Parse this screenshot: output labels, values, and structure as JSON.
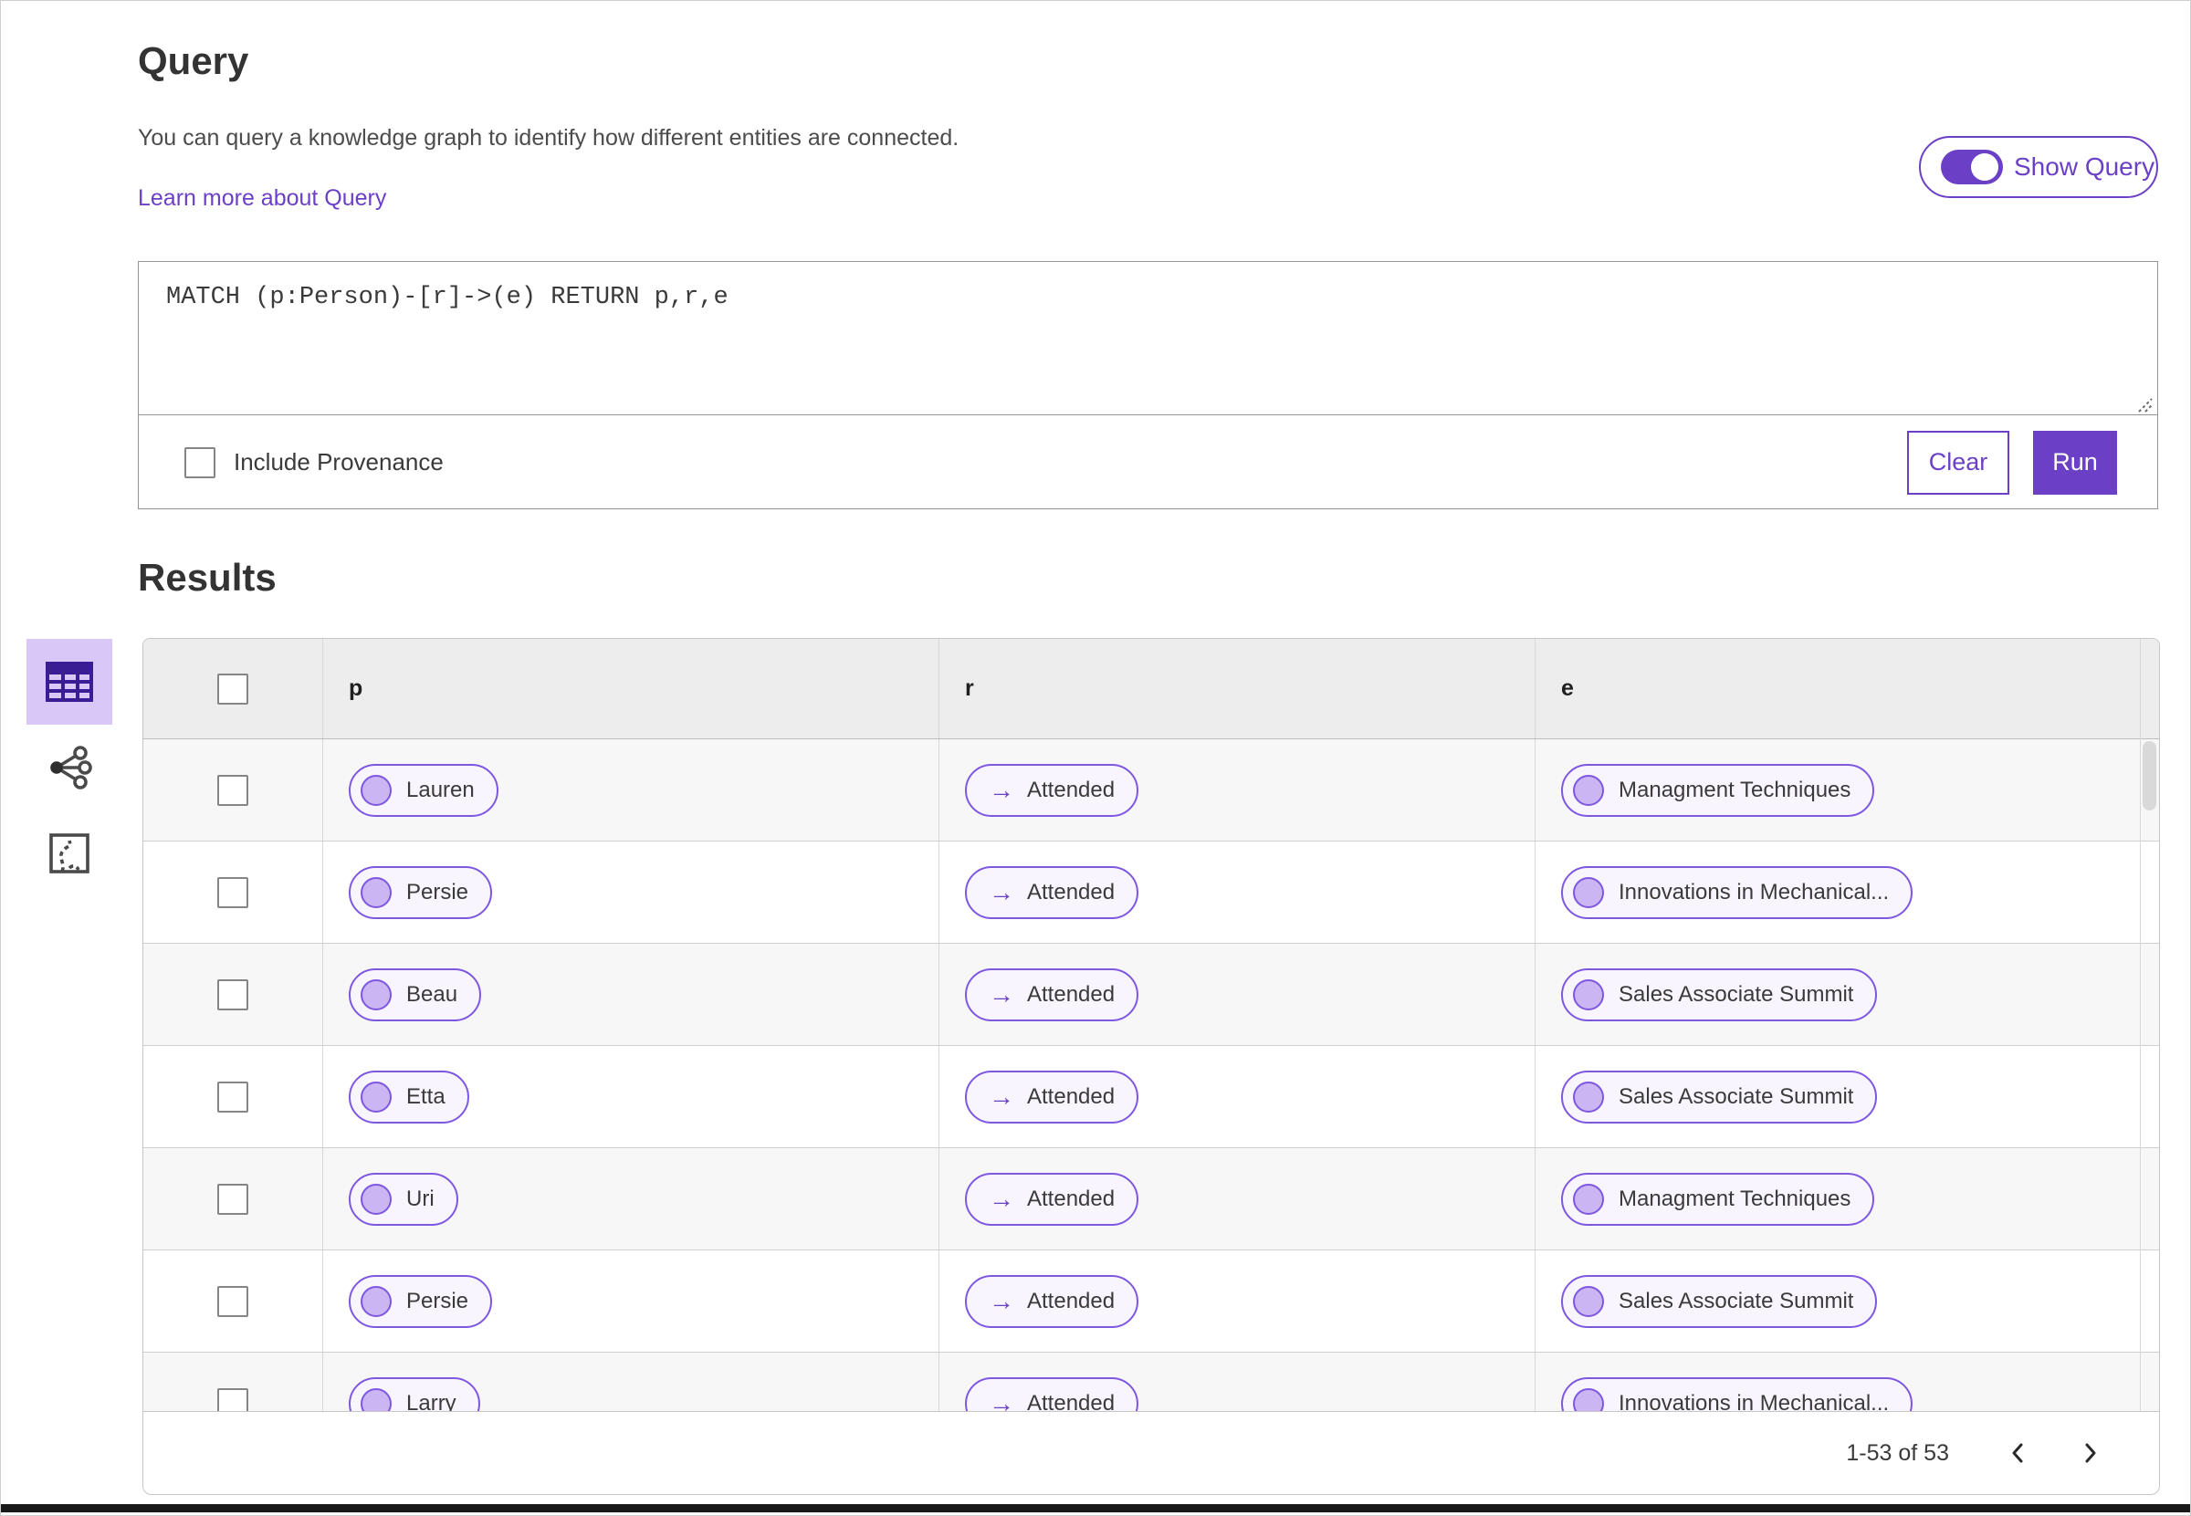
{
  "colors": {
    "accent": "#6C40C6",
    "pill-border": "#7E57E2",
    "pill-bg": "#F8F5FE",
    "node-fill": "#CBB5F2",
    "selected-view-bg": "#D8C7F7",
    "icon-purple": "#3A1D95",
    "header-bg": "#EDEDED",
    "row-alt-bg": "#F7F7F7",
    "border-gray": "#C6C6C6"
  },
  "icons": {
    "relation_arrow": "→",
    "view_switcher": [
      "table-icon",
      "network-icon",
      "map-route-icon"
    ]
  },
  "query_section": {
    "title": "Query",
    "description": "You can query a knowledge graph to identify how different entities are connected.",
    "learn_more_label": "Learn more about Query",
    "show_query_label": "Show Query",
    "show_query_on": true,
    "query_value": "MATCH (p:Person)-[r]->(e) RETURN p,r,e",
    "include_provenance_label": "Include Provenance",
    "include_provenance_checked": false,
    "clear_label": "Clear",
    "run_label": "Run"
  },
  "results": {
    "title": "Results",
    "table": {
      "columns": [
        "p",
        "r",
        "e"
      ],
      "rows": [
        {
          "p": "Lauren",
          "r": "Attended",
          "e": "Managment Techniques"
        },
        {
          "p": "Persie",
          "r": "Attended",
          "e": "Innovations in Mechanical..."
        },
        {
          "p": "Beau",
          "r": "Attended",
          "e": "Sales Associate Summit"
        },
        {
          "p": "Etta",
          "r": "Attended",
          "e": "Sales Associate Summit"
        },
        {
          "p": "Uri",
          "r": "Attended",
          "e": "Managment Techniques"
        },
        {
          "p": "Persie",
          "r": "Attended",
          "e": "Sales Associate Summit"
        },
        {
          "p": "Larry",
          "r": "Attended",
          "e": "Innovations in Mechanical..."
        }
      ]
    },
    "pagination": {
      "range_label": "1-53 of 53"
    }
  }
}
